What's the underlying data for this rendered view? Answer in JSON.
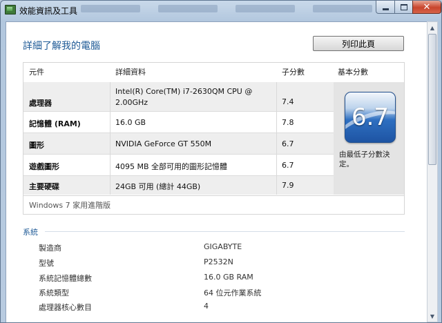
{
  "window": {
    "title": "效能資訊及工具",
    "close_glyph": "✕"
  },
  "page": {
    "title": "詳細了解我的電腦",
    "print_label": "列印此頁"
  },
  "score_table": {
    "headers": [
      "元件",
      "詳細資料",
      "子分數",
      "基本分數"
    ],
    "rows": [
      {
        "component": "處理器",
        "detail_line1": "Intel(R) Core(TM) i7-2630QM CPU @",
        "detail_line2": "2.00GHz",
        "subscore": "7.4"
      },
      {
        "component": "記憶體 (RAM)",
        "detail": "16.0 GB",
        "subscore": "7.8"
      },
      {
        "component": "圖形",
        "detail": "NVIDIA GeForce GT 550M",
        "subscore": "6.7"
      },
      {
        "component": "遊戲圖形",
        "detail": "4095 MB 全部可用的圖形記憶體",
        "subscore": "6.7"
      },
      {
        "component": "主要硬碟",
        "detail": "24GB 可用 (總計 44GB)",
        "subscore": "7.9"
      }
    ],
    "base_score": "6.7",
    "base_caption": "由最低子分數決定。",
    "edition": "Windows 7 家用進階版"
  },
  "system": {
    "title": "系統",
    "rows": [
      {
        "label": "製造商",
        "value": "GIGABYTE"
      },
      {
        "label": "型號",
        "value": "P2532N"
      },
      {
        "label": "系統記憶體總數",
        "value": "16.0 GB RAM"
      },
      {
        "label": "系統類型",
        "value": "64 位元作業系統"
      },
      {
        "label": "處理器核心數目",
        "value": "4"
      }
    ]
  },
  "icons": {
    "app": "performance-info-icon",
    "minimize": "minimize-icon",
    "maximize": "maximize-icon",
    "close": "close-icon"
  },
  "colors": {
    "accent": "#1e5a96",
    "close_button": "#c8452c",
    "score_badge": "#2e6fc1"
  }
}
